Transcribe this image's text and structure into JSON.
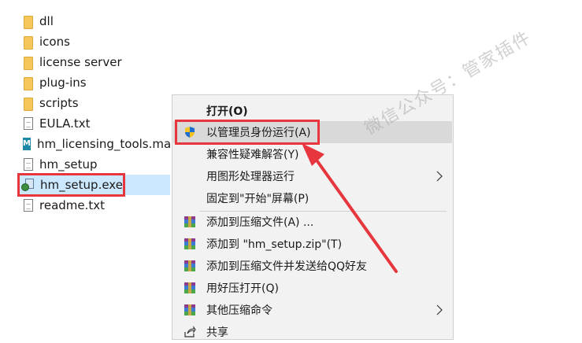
{
  "explorer": {
    "files": [
      {
        "name": "dll",
        "icon": "folder-icon"
      },
      {
        "name": "icons",
        "icon": "folder-icon"
      },
      {
        "name": "license server",
        "icon": "folder-icon"
      },
      {
        "name": "plug-ins",
        "icon": "folder-icon"
      },
      {
        "name": "scripts",
        "icon": "folder-icon"
      },
      {
        "name": "EULA.txt",
        "icon": "text-file-icon"
      },
      {
        "name": "hm_licensing_tools.ma",
        "icon": "ma-file-icon"
      },
      {
        "name": "hm_setup",
        "icon": "file-icon"
      },
      {
        "name": "hm_setup.exe",
        "icon": "exe-icon",
        "selected": true
      },
      {
        "name": "readme.txt",
        "icon": "text-file-icon"
      }
    ]
  },
  "context_menu": {
    "items": [
      {
        "label": "打开(O)",
        "bold": true
      },
      {
        "label": "以管理员身份运行(A)",
        "icon": "shield-icon",
        "hovered": true
      },
      {
        "label": "兼容性疑难解答(Y)"
      },
      {
        "label": "用图形处理器运行",
        "submenu": true
      },
      {
        "label": "固定到\"开始\"屏幕(P)"
      },
      {
        "label": "添加到压缩文件(A) ...",
        "icon": "winrar-icon"
      },
      {
        "label": "添加到 \"hm_setup.zip\"(T)",
        "icon": "winrar-icon"
      },
      {
        "label": "添加到压缩文件并发送给QQ好友",
        "icon": "winrar-icon"
      },
      {
        "label": "用好压打开(Q)",
        "icon": "winrar-icon"
      },
      {
        "label": "其他压缩命令",
        "icon": "winrar-icon",
        "submenu": true
      },
      {
        "label": "共享",
        "icon": "share-icon"
      }
    ]
  },
  "watermark": "微信公众号：管家插件",
  "colors": {
    "accent_red": "#e8363f",
    "selection_blue": "#cce8ff",
    "menu_bg": "#f2f2f2",
    "menu_hover": "#d9d9d9"
  }
}
